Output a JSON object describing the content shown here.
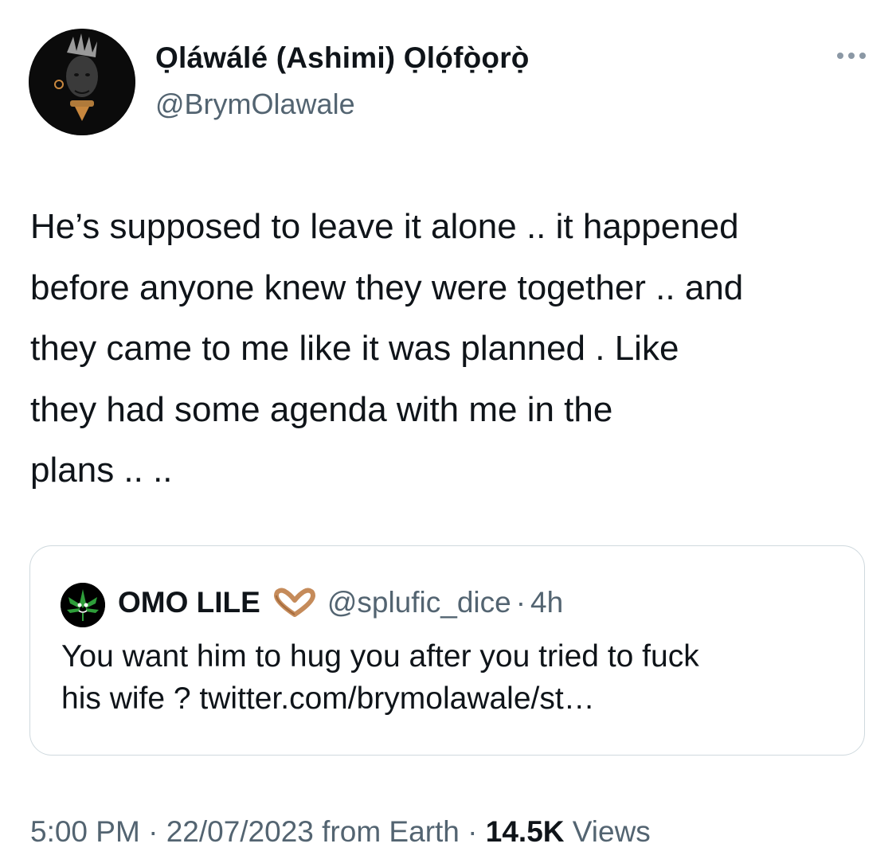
{
  "author": {
    "display_name": "Ọláwálé (Ashimi) Ọlọ́fọ̀ọrọ̀",
    "handle": "@BrymOlawale",
    "avatar_icon": "portrait-avatar-icon"
  },
  "more_icon": "more-horizontal-icon",
  "tweet": {
    "lines": [
      "He’s supposed to leave it alone .. it happened",
      "before anyone knew they were together .. and",
      "they came to me like it was planned . Like",
      "they had some agenda with me in the",
      "plans .. .."
    ]
  },
  "quoted": {
    "display_name": "OMO LILE",
    "emoji_icon": "heart-hands-icon",
    "avatar_icon": "cannabis-leaf-avatar-icon",
    "handle": "@splufic_dice",
    "separator": "·",
    "time": "4h",
    "lines": [
      "You want him to hug you after you tried to fuck",
      "his wife ? twitter.com/brymolawale/st…"
    ]
  },
  "meta": {
    "time": "5:00 PM",
    "sep1": " · ",
    "date": "22/07/2023",
    "source": " from Earth",
    "sep2": " · ",
    "views_count": "14.5K",
    "views_label": " Views"
  },
  "colors": {
    "text": "#0f1419",
    "secondary": "#536471",
    "border": "#cfd9de",
    "leaf_green": "#2e9e3a"
  }
}
